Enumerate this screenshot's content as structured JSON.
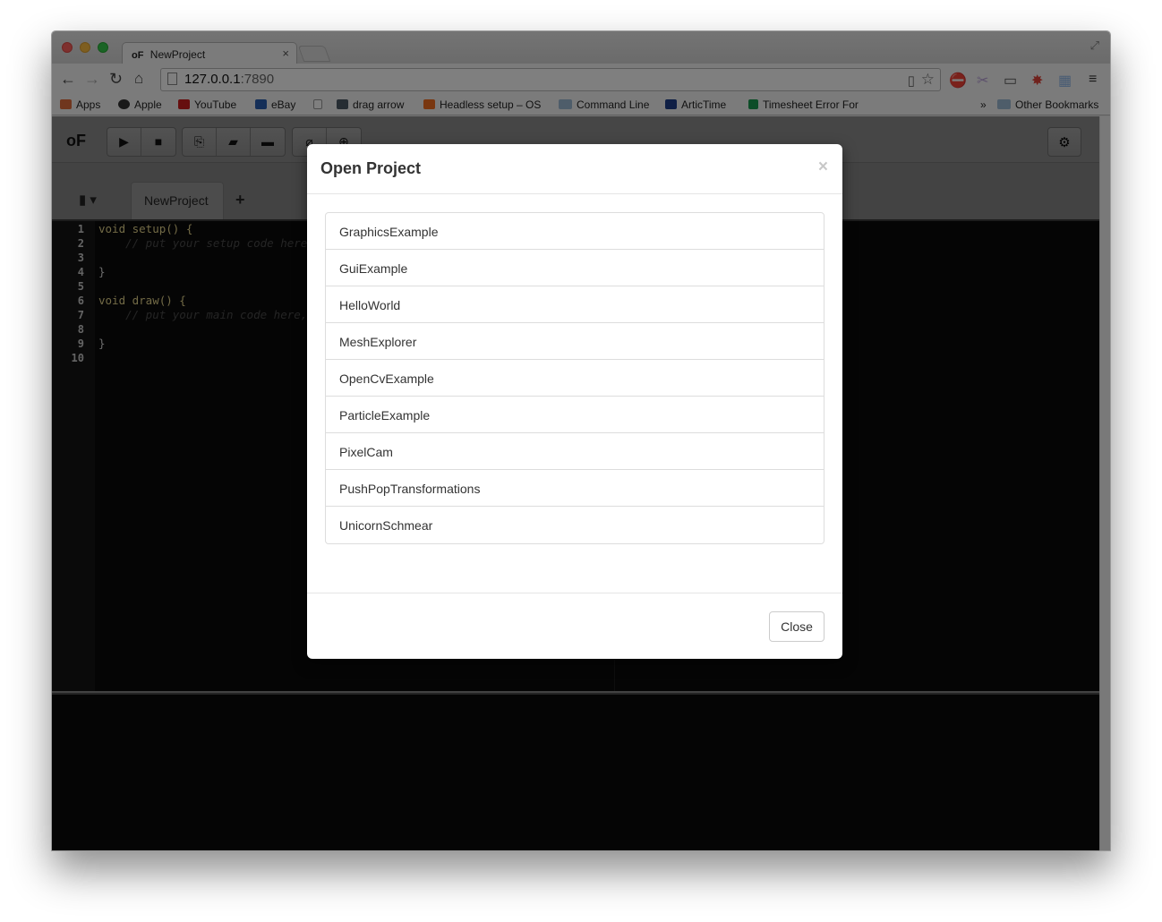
{
  "browser": {
    "tab_title": "NewProject",
    "tab_favicon": "oF",
    "tab_close": "×",
    "url_host": "127.0.0.1",
    "url_port": ":7890",
    "bookmarks": [
      {
        "label": "Apps",
        "icon": "apps-grid-icon",
        "color": "#e06c3c"
      },
      {
        "label": "Apple",
        "icon": "apple-icon",
        "color": "#333333"
      },
      {
        "label": "YouTube",
        "icon": "youtube-icon",
        "color": "#cc1e1e"
      },
      {
        "label": "eBay",
        "icon": "ebay-icon",
        "color": "#2a5fb0"
      },
      {
        "label": "",
        "icon": "blank-page-icon",
        "color": "#ffffff"
      },
      {
        "label": "drag arrow",
        "icon": "terminal-icon",
        "color": "#4c5a66"
      },
      {
        "label": "Headless setup – OS",
        "icon": "blogger-icon",
        "color": "#f26f21"
      },
      {
        "label": "Command Line",
        "icon": "folder-icon",
        "color": "#9dbad5"
      },
      {
        "label": "ArticTime",
        "icon": "w-logo-icon",
        "color": "#1f3f8a"
      },
      {
        "label": "Timesheet Error For",
        "icon": "sheets-icon",
        "color": "#1a9b50"
      }
    ],
    "more_bookmarks": "»",
    "other_bookmarks": "Other Bookmarks"
  },
  "app": {
    "logo": "oF",
    "file_tab": "NewProject",
    "add_tab": "+",
    "code_lines": [
      {
        "n": "1",
        "text": "void setup() {"
      },
      {
        "n": "2",
        "text": "    // put your setup code here,"
      },
      {
        "n": "3",
        "text": ""
      },
      {
        "n": "4",
        "text": "}"
      },
      {
        "n": "5",
        "text": ""
      },
      {
        "n": "6",
        "text": "void draw() {"
      },
      {
        "n": "7",
        "text": "    // put your main code here,"
      },
      {
        "n": "8",
        "text": ""
      },
      {
        "n": "9",
        "text": "}"
      },
      {
        "n": "10",
        "text": ""
      }
    ]
  },
  "modal": {
    "title": "Open Project",
    "close_x": "×",
    "projects": [
      "GraphicsExample",
      "GuiExample",
      "HelloWorld",
      "MeshExplorer",
      "OpenCvExample",
      "ParticleExample",
      "PixelCam",
      "PushPopTransformations",
      "UnicornSchmear"
    ],
    "close_button": "Close"
  }
}
